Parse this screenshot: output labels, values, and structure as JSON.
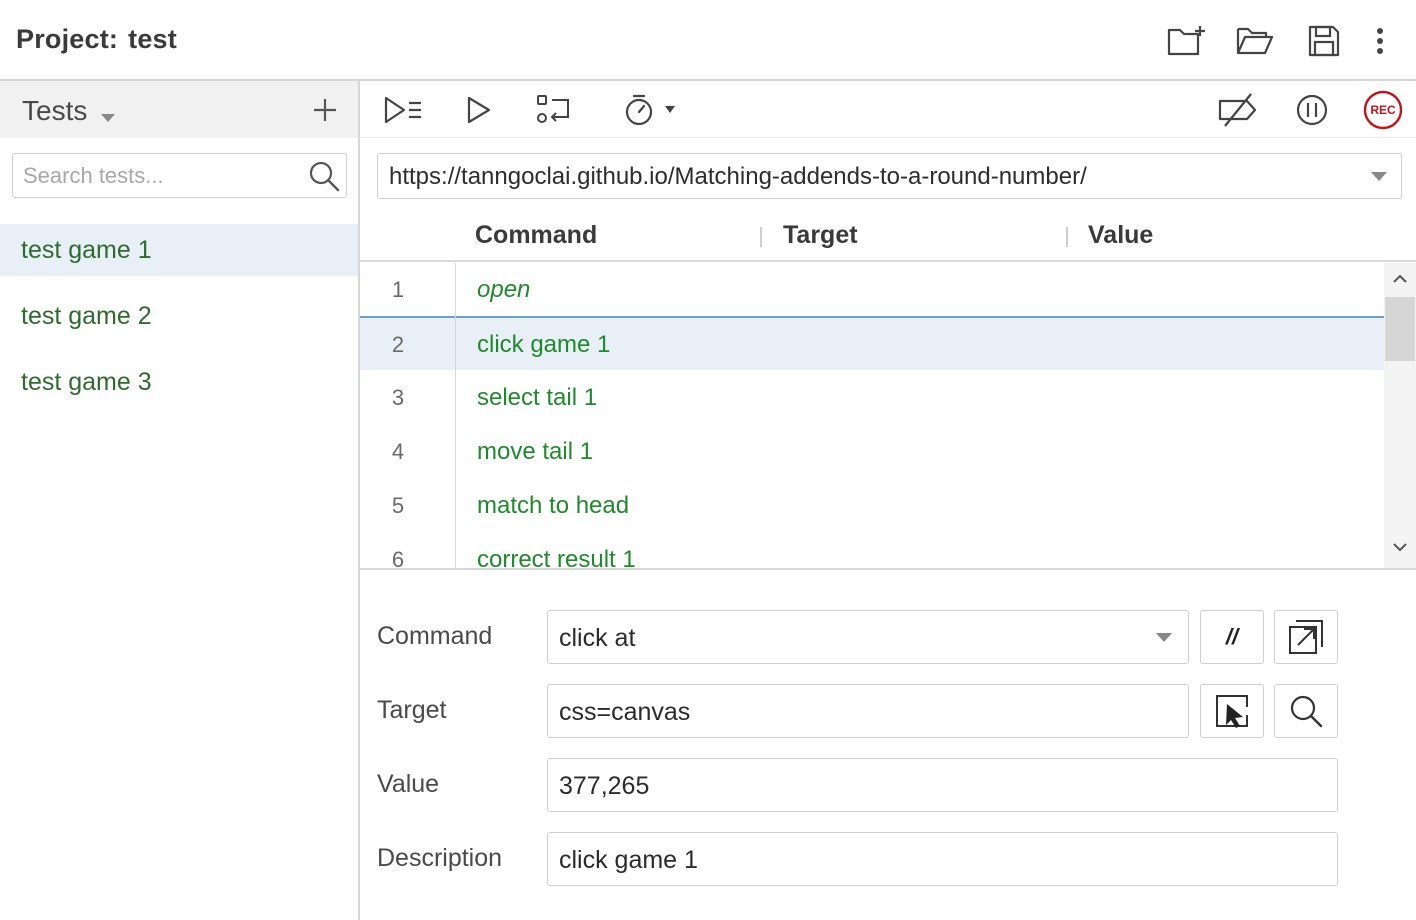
{
  "header": {
    "project_label": "Project:",
    "project_name": "test",
    "icons": [
      "new-project-icon",
      "open-folder-icon",
      "save-icon",
      "more-vertical-icon"
    ]
  },
  "sidebar": {
    "title": "Tests",
    "search_placeholder": "Search tests...",
    "tests": [
      {
        "label": "test game 1",
        "active": true
      },
      {
        "label": "test game 2",
        "active": false
      },
      {
        "label": "test game 3",
        "active": false
      }
    ]
  },
  "toolbar": {
    "icons": [
      "run-all-icon",
      "run-icon",
      "step-icon",
      "speed-timer-icon",
      "disable-breakpoints-icon",
      "pause-icon"
    ],
    "record_label": "REC"
  },
  "url": "https://tanngoclai.github.io/Matching-addends-to-a-round-number/",
  "table": {
    "columns": [
      "Command",
      "Target",
      "Value"
    ],
    "rows": [
      {
        "num": "1",
        "command": "open",
        "italic": true
      },
      {
        "num": "2",
        "command": "click game 1",
        "selected": true
      },
      {
        "num": "3",
        "command": "select tail 1"
      },
      {
        "num": "4",
        "command": "move tail 1"
      },
      {
        "num": "5",
        "command": "match to head"
      },
      {
        "num": "6",
        "command": "correct result 1"
      }
    ]
  },
  "editor": {
    "command_label": "Command",
    "command_value": "click at",
    "comment_button": "//",
    "target_label": "Target",
    "target_value": "css=canvas",
    "value_label": "Value",
    "value_value": "377,265",
    "description_label": "Description",
    "description_value": "click game 1"
  },
  "colors": {
    "command_green": "#1f8a2c",
    "test_green": "#2f6b2f",
    "selection_bg": "#e8eff7",
    "selection_border": "#6d9fd6",
    "rec_red": "#c0151b"
  }
}
